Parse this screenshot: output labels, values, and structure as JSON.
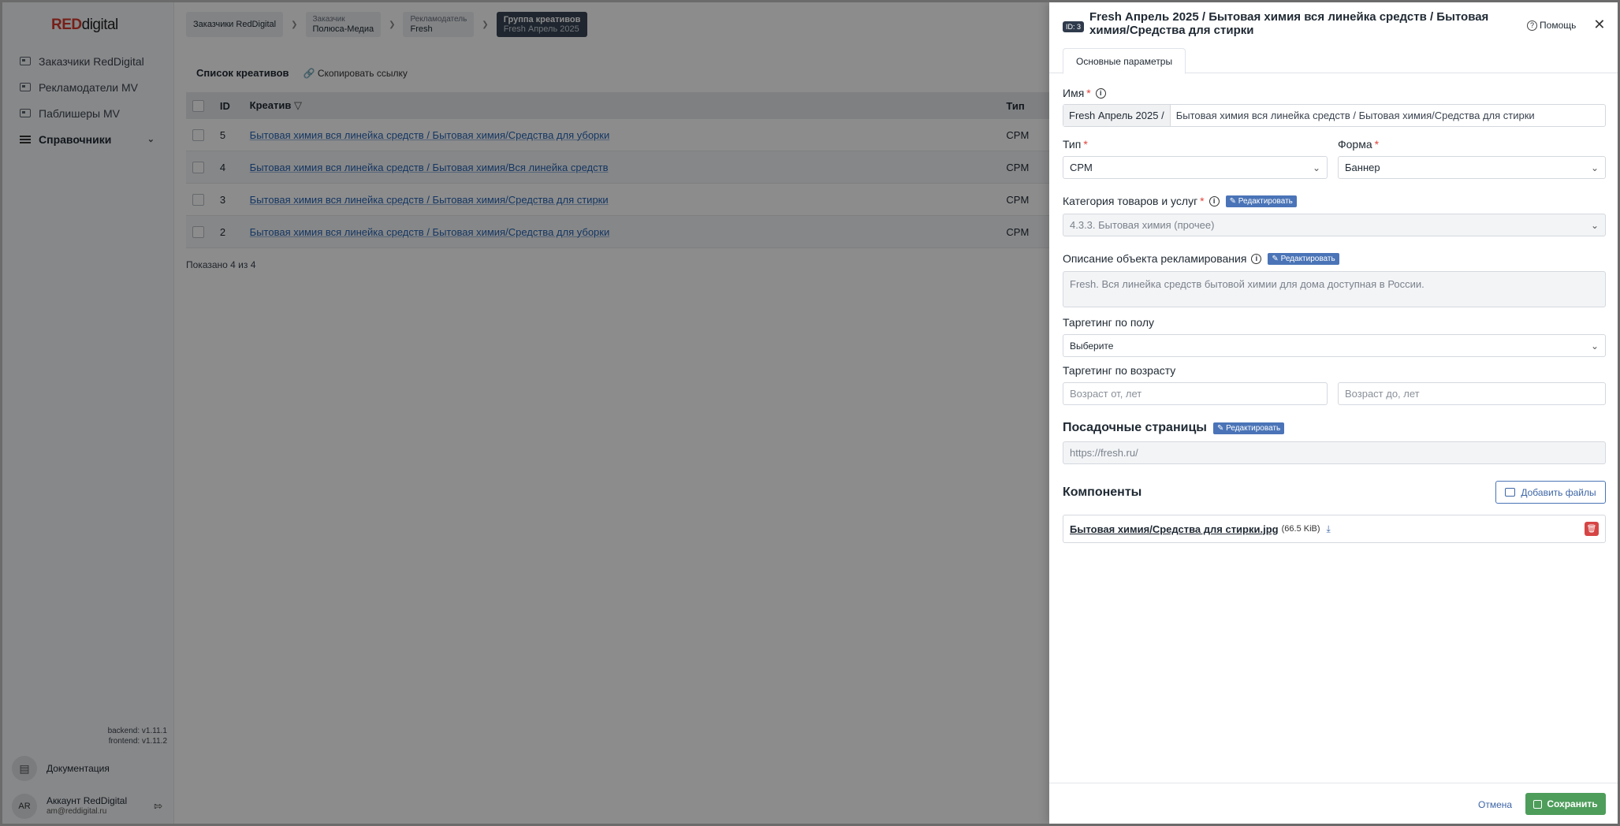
{
  "sidebar": {
    "logo_red": "RED",
    "logo_digital": "digital",
    "items": [
      {
        "label": "Заказчики RedDigital"
      },
      {
        "label": "Рекламодатели MV"
      },
      {
        "label": "Паблишеры MV"
      },
      {
        "label": "Справочники"
      }
    ],
    "backend_version": "backend: v1.11.1",
    "frontend_version": "frontend: v1.11.2",
    "docs_label": "Документация",
    "account_initials": "AR",
    "account_name": "Аккаунт RedDigital",
    "account_email": "am@reddigital.ru"
  },
  "breadcrumbs": [
    {
      "small": "",
      "big": "Заказчики RedDigital"
    },
    {
      "small": "Заказчик",
      "big": "Полюса-Медиа"
    },
    {
      "small": "Рекламодатель",
      "big": "Fresh"
    },
    {
      "small": "Группа креативов",
      "big": "Fresh Апрель 2025"
    }
  ],
  "list": {
    "title": "Список креативов",
    "copy_link": "Скопировать ссылку",
    "columns": {
      "id": "ID",
      "creative": "Креатив",
      "type": "Тип"
    },
    "rows": [
      {
        "id": "5",
        "creative": "Бытовая химия вся линейка средств / Бытовая химия/Средства для уборки",
        "type": "CPM"
      },
      {
        "id": "4",
        "creative": "Бытовая химия вся линейка средств / Бытовая химия/Вся линейка средств",
        "type": "CPM"
      },
      {
        "id": "3",
        "creative": "Бытовая химия вся линейка средств / Бытовая химия/Средства для стирки",
        "type": "CPM"
      },
      {
        "id": "2",
        "creative": "Бытовая химия вся линейка средств / Бытовая химия/Средства для уборки",
        "type": "CPM"
      }
    ],
    "shown": "Показано 4 из 4"
  },
  "drawer": {
    "id_badge": "ID: 3",
    "title": "Fresh Апрель 2025 / Бытовая химия вся линейка средств / Бытовая химия/Средства для стирки",
    "help": "Помощь",
    "tab": "Основные параметры",
    "name_label": "Имя",
    "name_prefix": "Fresh Апрель 2025 /",
    "name_value": "Бытовая химия вся линейка средств / Бытовая химия/Средства для стирки",
    "type_label": "Тип",
    "type_value": "CPM",
    "form_label": "Форма",
    "form_value": "Баннер",
    "category_label": "Категория товаров и услуг",
    "edit_label": "Редактировать",
    "category_value": "4.3.3. Бытовая химия (прочее)",
    "description_label": "Описание объекта рекламирования",
    "description_value": "Fresh. Вся линейка средств бытовой химии для дома доступная в России.",
    "gender_label": "Таргетинг по полу",
    "gender_placeholder": "Выберите",
    "age_label": "Таргетинг по возрасту",
    "age_from_placeholder": "Возраст от, лет",
    "age_to_placeholder": "Возраст до, лет",
    "landing_title": "Посадочные страницы",
    "landing_value": "https://fresh.ru/",
    "components_title": "Компоненты",
    "add_files": "Добавить файлы",
    "file_name": "Бытовая химия/Средства для стирки.jpg",
    "file_size": "(66.5 KiB)",
    "cancel": "Отмена",
    "save": "Сохранить"
  }
}
